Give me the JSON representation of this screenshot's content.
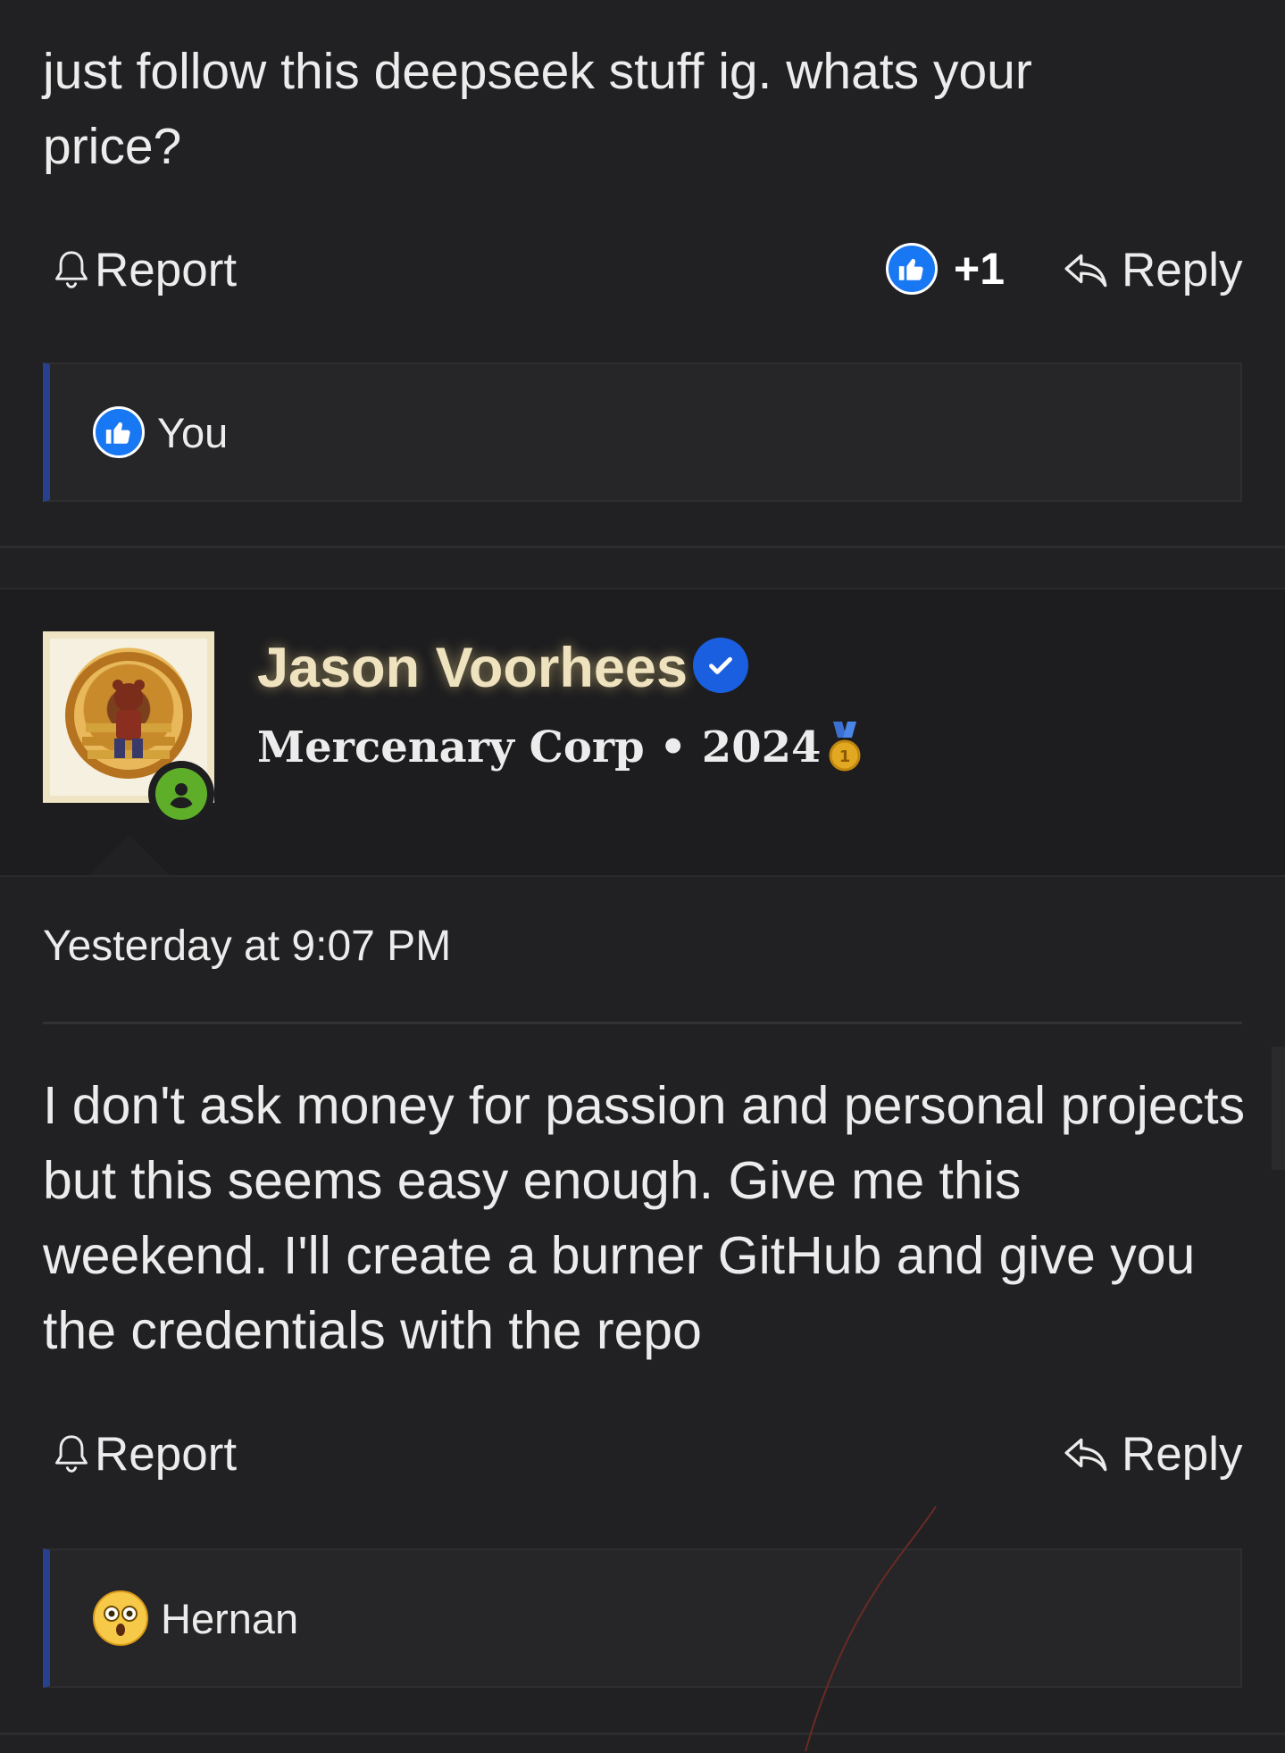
{
  "top_post": {
    "body": "just follow this deepseek stuff ig. whats your price?",
    "report_label": "Report",
    "like_count": "+1",
    "reply_label": "Reply",
    "reactions": [
      {
        "icon": "like-icon",
        "name": "You"
      }
    ]
  },
  "post": {
    "author": {
      "name": "Jason Voorhees",
      "title": "Mercenary Corp • 2024",
      "verified": true,
      "online": true
    },
    "timestamp": "Yesterday at 9:07 PM",
    "body": "I don't ask money for passion and personal projects but this seems easy enough. Give me this weekend. I'll create a burner GitHub and give you the credentials with the repo",
    "report_label": "Report",
    "reply_label": "Reply",
    "reactions": [
      {
        "icon": "shocked-face-icon",
        "name": "Hernan"
      }
    ]
  },
  "colors": {
    "background": "#212123",
    "accent_blue": "#1877f2",
    "reaction_bar": "#27418f",
    "username_gold": "#efe3bf",
    "online_green": "#5fae2a"
  }
}
